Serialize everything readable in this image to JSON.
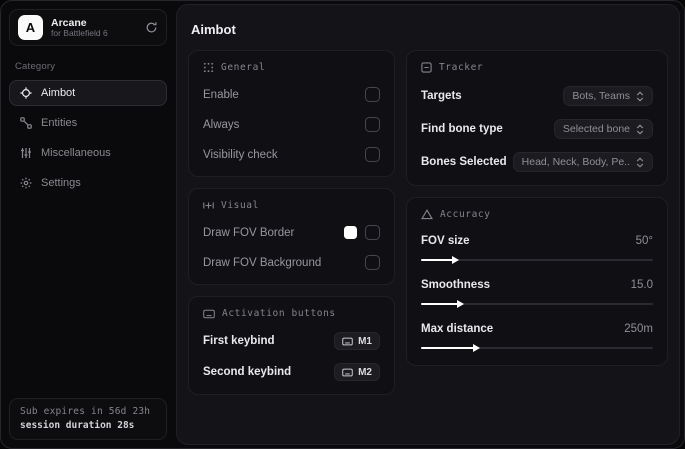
{
  "colors": {
    "accent_swatch": "#ffffff",
    "panel_bg": "#141418",
    "card_bg": "#101014",
    "active_item_bg": "#17171c"
  },
  "sidebar": {
    "logo": {
      "initial": "A",
      "title": "Arcane",
      "subtitle": "for Battlefield 6"
    },
    "category_label": "Category",
    "items": [
      {
        "label": "Aimbot",
        "icon": "crosshair-icon",
        "active": true
      },
      {
        "label": "Entities",
        "icon": "nodes-icon",
        "active": false
      },
      {
        "label": "Miscellaneous",
        "icon": "sliders-icon",
        "active": false
      },
      {
        "label": "Settings",
        "icon": "gear-icon",
        "active": false
      }
    ],
    "footer": {
      "line1": "Sub expires in 56d 23h",
      "line2": "session duration 28s"
    }
  },
  "main": {
    "title": "Aimbot",
    "general": {
      "title": "General",
      "rows": [
        {
          "label": "Enable",
          "control": "checkbox",
          "checked": false
        },
        {
          "label": "Always",
          "control": "checkbox",
          "checked": false
        },
        {
          "label": "Visibility check",
          "control": "checkbox",
          "checked": false
        }
      ]
    },
    "visual": {
      "title": "Visual",
      "rows": [
        {
          "label": "Draw FOV Border",
          "control": "swatch+checkbox",
          "swatch_color": "#ffffff",
          "checked": false
        },
        {
          "label": "Draw FOV Background",
          "control": "checkbox",
          "checked": false
        }
      ]
    },
    "activation": {
      "title": "Activation buttons",
      "rows": [
        {
          "label": "First keybind",
          "key": "M1"
        },
        {
          "label": "Second keybind",
          "key": "M2"
        }
      ]
    },
    "tracker": {
      "title": "Tracker",
      "rows": [
        {
          "label": "Targets",
          "value": "Bots, Teams"
        },
        {
          "label": "Find bone type",
          "value": "Selected bone"
        },
        {
          "label": "Bones Selected",
          "value": "Head, Neck, Body, Pe.."
        }
      ]
    },
    "accuracy": {
      "title": "Accuracy",
      "rows": [
        {
          "label": "FOV size",
          "value": "50°",
          "fill_pct": 14
        },
        {
          "label": "Smoothness",
          "value": "15.0",
          "fill_pct": 16
        },
        {
          "label": "Max distance",
          "value": "250m",
          "fill_pct": 23
        }
      ]
    }
  }
}
